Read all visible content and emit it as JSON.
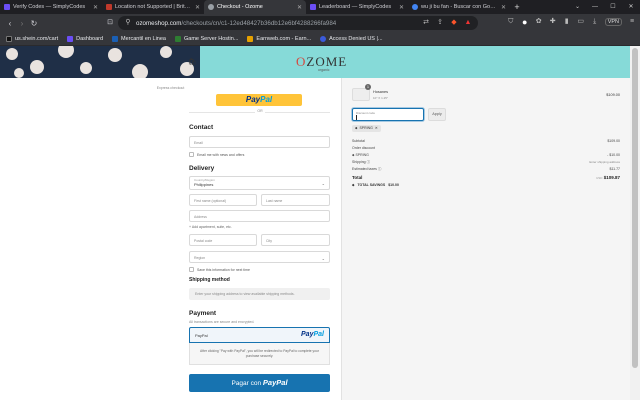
{
  "browser": {
    "tabs": [
      {
        "label": "Verify Codes — SimplyCodes",
        "color": "#6b4ef6",
        "active": false
      },
      {
        "label": "Location not Supported | BritBox",
        "color": "#c0392b",
        "active": false
      },
      {
        "label": "Checkout - Ozome",
        "color": "#9aa0a6",
        "active": true
      },
      {
        "label": "Leaderboard — SimplyCodes",
        "color": "#6b4ef6",
        "active": false
      },
      {
        "label": "wu ji bu fan - Buscar con Google",
        "color": "#4285f4",
        "active": false
      }
    ],
    "url_domain": "ozomeshop.com",
    "url_path": "/checkouts/cn/c1-12ed48427b36db12e6bf4288266fa984",
    "vpn_label": "VPN",
    "bookmarks": [
      {
        "label": "us.shein.com/cart",
        "color": "#111111"
      },
      {
        "label": "Dashboard",
        "color": "#6b4ef6"
      },
      {
        "label": "Mercantil en Linea",
        "color": "#1a5fb4"
      },
      {
        "label": "Game Server Hostin...",
        "color": "#2e7d32"
      },
      {
        "label": "Earnweb.com - Earn...",
        "color": "#e6a100"
      },
      {
        "label": "Access Denied US |...",
        "color": "#3b5bdb"
      }
    ]
  },
  "header": {
    "logo": "OZOME",
    "logo_sub": "organic"
  },
  "checkout": {
    "express_label": "Express checkout",
    "paypal_pay": "Pay",
    "paypal_pal": "Pal",
    "or_label": "OR",
    "contact_title": "Contact",
    "email_placeholder": "Email",
    "email_news_label": "Email me with news and offers",
    "delivery_title": "Delivery",
    "country_label": "Country/Region",
    "country_value": "Philippines",
    "first_name_placeholder": "First name (optional)",
    "last_name_placeholder": "Last name",
    "address_placeholder": "Address",
    "add_apartment_label": "+ Add apartment, suite, etc.",
    "postal_placeholder": "Postal code",
    "city_placeholder": "City",
    "region_placeholder": "Region",
    "save_info_label": "Save this information for next time",
    "shipping_method_title": "Shipping method",
    "shipping_method_text": "Enter your shipping address to view available shipping methods.",
    "payment_title": "Payment",
    "payment_sub": "All transactions are secure and encrypted.",
    "payment_option": "PayPal",
    "paypal_redirect_text": "After clicking \"Pay with PayPal\", you will be redirected to PayPal to complete your purchase securely.",
    "pay_button_prefix": "Pagar con"
  },
  "summary": {
    "product_qty": "1",
    "product_name": "Hosanes",
    "product_variant": "10\" X 1.25\"",
    "product_price": "$109.00",
    "discount_placeholder": "Discount code",
    "apply_label": "Apply",
    "chip_label": "SPRING",
    "subtotal_label": "Subtotal",
    "subtotal_value": "$109.00",
    "order_discount_label": "Order discount",
    "discount_code_label": "SPRING",
    "discount_value": "- $10.00",
    "shipping_label": "Shipping",
    "shipping_value": "Enter shipping address",
    "taxes_label": "Estimated taxes",
    "taxes_value": "$11.77",
    "total_label": "Total",
    "total_currency": "USD",
    "total_value": "$109.87",
    "savings_label": "TOTAL SAVINGS",
    "savings_value": "$10.00"
  }
}
